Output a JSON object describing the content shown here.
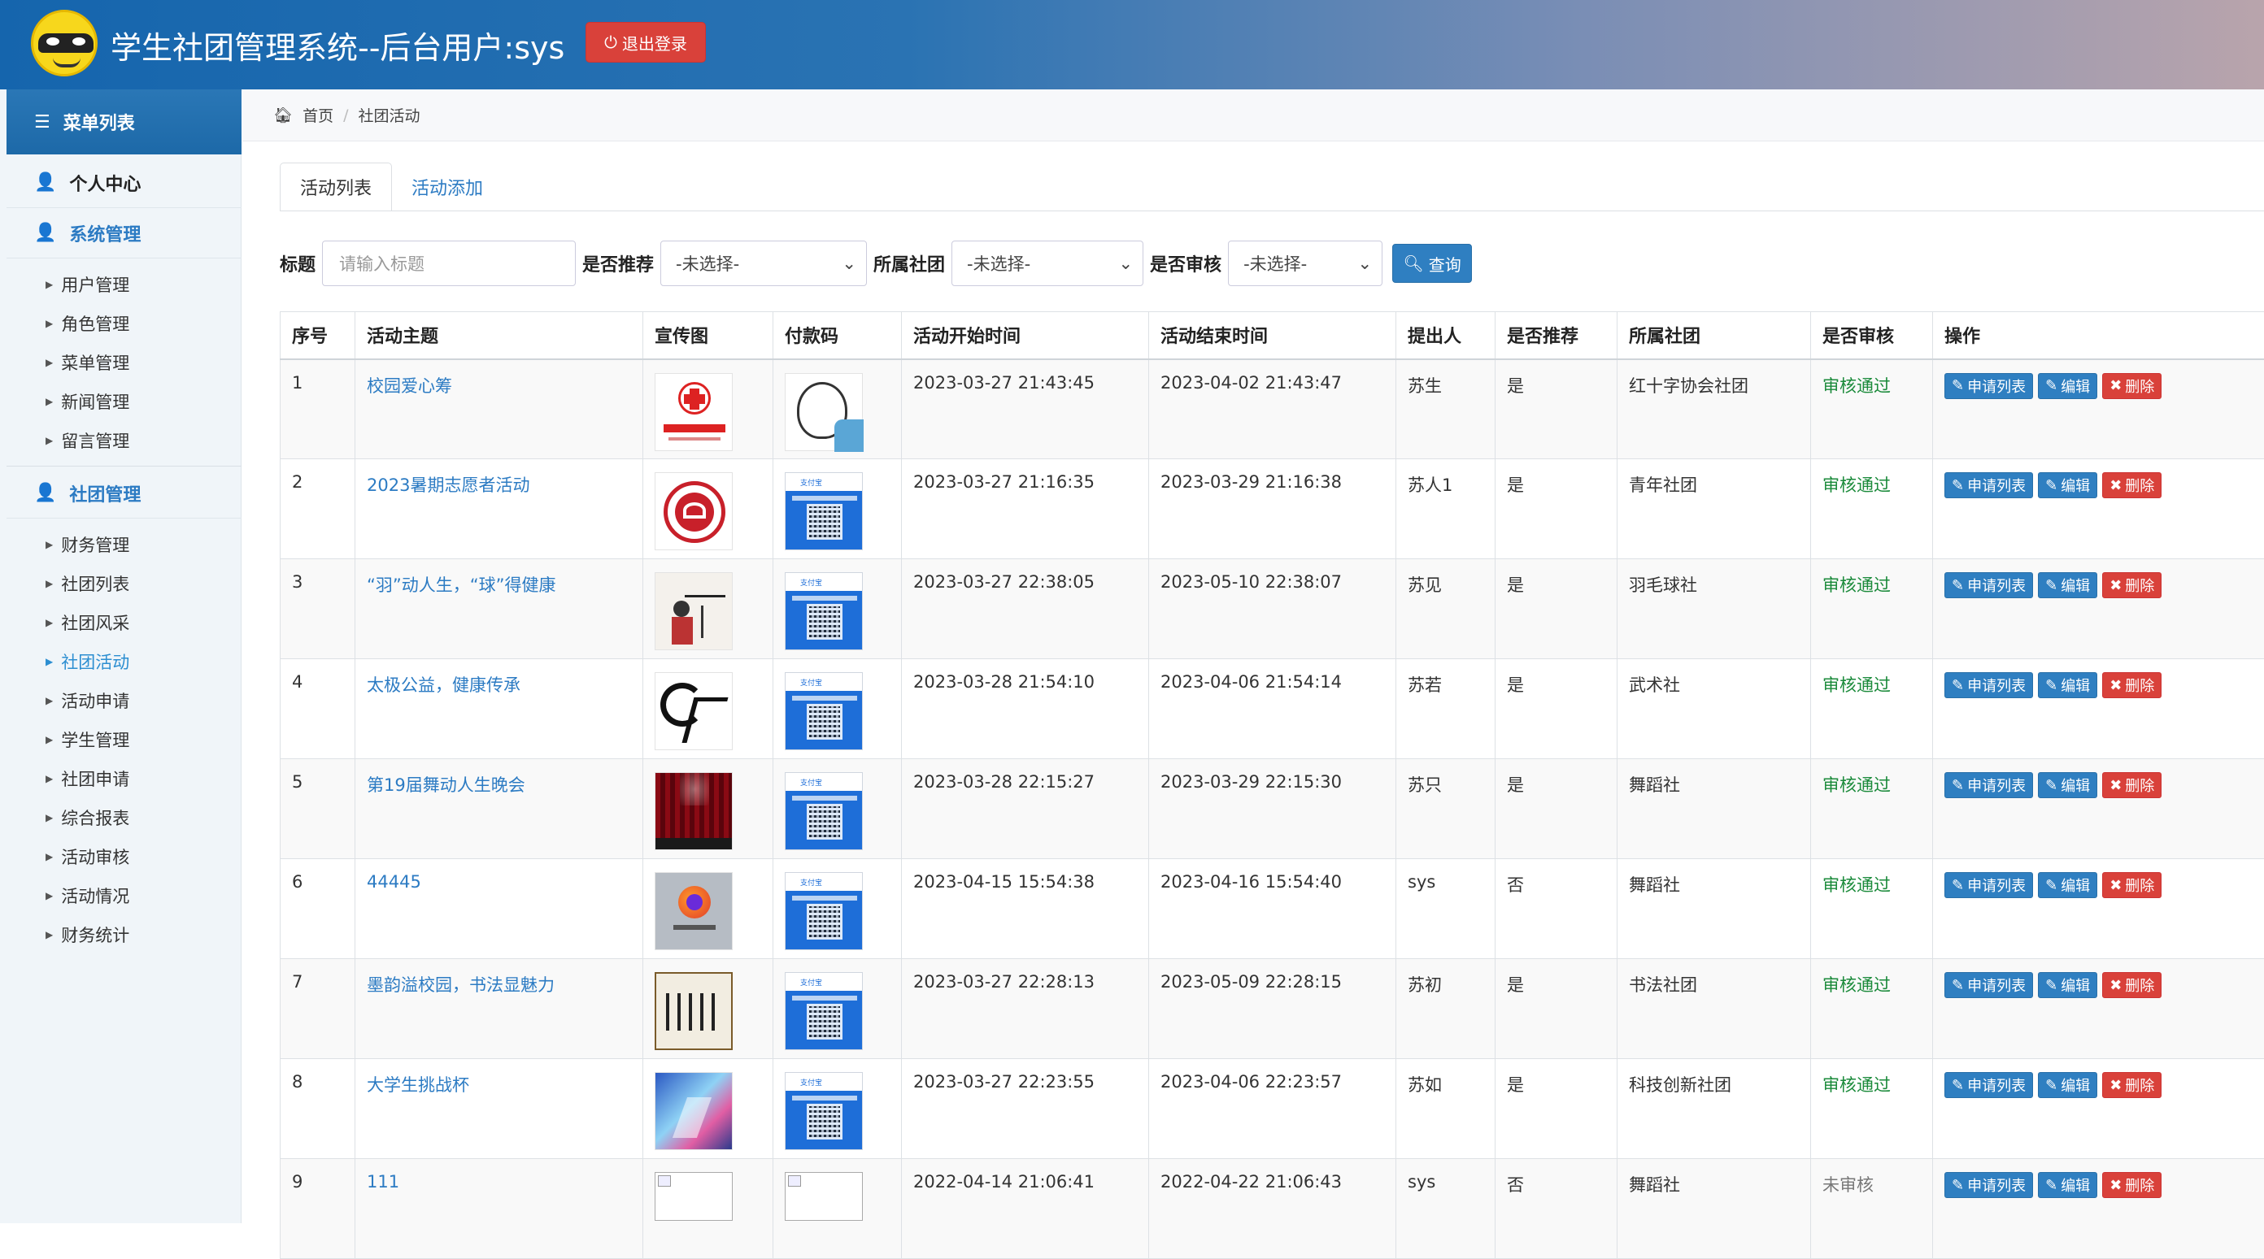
{
  "header": {
    "title": "学生社团管理系统--后台用户:sys",
    "logout_label": "退出登录"
  },
  "sidebar": {
    "menu_title": "菜单列表",
    "personal_center": "个人中心",
    "system_management": "系统管理",
    "system_items": [
      "用户管理",
      "角色管理",
      "菜单管理",
      "新闻管理",
      "留言管理"
    ],
    "club_management": "社团管理",
    "club_items": [
      "财务管理",
      "社团列表",
      "社团风采",
      "社团活动",
      "活动申请",
      "学生管理",
      "社团申请",
      "综合报表",
      "活动审核",
      "活动情况",
      "财务统计"
    ],
    "active_item": "社团活动"
  },
  "breadcrumb": {
    "home": "首页",
    "current": "社团活动"
  },
  "tabs": {
    "list": "活动列表",
    "add": "活动添加"
  },
  "filters": {
    "title_label": "标题",
    "title_placeholder": "请输入标题",
    "recommend_label": "是否推荐",
    "recommend_value": "-未选择-",
    "club_label": "所属社团",
    "club_value": "-未选择-",
    "audit_label": "是否审核",
    "audit_value": "-未选择-",
    "query_label": "查询"
  },
  "table": {
    "columns": [
      "序号",
      "活动主题",
      "宣传图",
      "付款码",
      "活动开始时间",
      "活动结束时间",
      "提出人",
      "是否推荐",
      "所属社团",
      "是否审核",
      "操作"
    ],
    "op_labels": {
      "apply": "申请列表",
      "edit": "编辑",
      "delete": "删除"
    },
    "rows": [
      {
        "no": "1",
        "topic": "校园爱心筹",
        "poster": "red-cross-logo",
        "pay": "sketch-avatar",
        "start": "2023-03-27 21:43:45",
        "end": "2023-04-02 21:43:47",
        "proposer": "苏生",
        "recommend": "是",
        "club": "红十字协会社团",
        "audit": "审核通过"
      },
      {
        "no": "2",
        "topic": "2023暑期志愿者活动",
        "poster": "volunteer-logo",
        "pay": "qr-code",
        "start": "2023-03-27 21:16:35",
        "end": "2023-03-29 21:16:38",
        "proposer": "苏人1",
        "recommend": "是",
        "club": "青年社团",
        "audit": "审核通过"
      },
      {
        "no": "3",
        "topic": "“羽”动人生，“球”得健康",
        "poster": "badminton-poster",
        "pay": "qr-code",
        "start": "2023-03-27 22:38:05",
        "end": "2023-05-10 22:38:07",
        "proposer": "苏见",
        "recommend": "是",
        "club": "羽毛球社",
        "audit": "审核通过"
      },
      {
        "no": "4",
        "topic": "太极公益，健康传承",
        "poster": "wushu-calligraphy",
        "pay": "qr-code",
        "start": "2023-03-28 21:54:10",
        "end": "2023-04-06 21:54:14",
        "proposer": "苏若",
        "recommend": "是",
        "club": "武术社",
        "audit": "审核通过"
      },
      {
        "no": "5",
        "topic": "第19届舞动人生晚会",
        "poster": "stage-curtain",
        "pay": "qr-code",
        "start": "2023-03-28 22:15:27",
        "end": "2023-03-29 22:15:30",
        "proposer": "苏只",
        "recommend": "是",
        "club": "舞蹈社",
        "audit": "审核通过"
      },
      {
        "no": "6",
        "topic": "44445",
        "poster": "firefox-screenshot",
        "pay": "qr-code",
        "start": "2023-04-15 15:54:38",
        "end": "2023-04-16 15:54:40",
        "proposer": "sys",
        "recommend": "否",
        "club": "舞蹈社",
        "audit": "审核通过"
      },
      {
        "no": "7",
        "topic": "墨韵溢校园，书法显魅力",
        "poster": "calligraphy-scroll",
        "pay": "qr-code",
        "start": "2023-03-27 22:28:13",
        "end": "2023-05-09 22:28:15",
        "proposer": "苏初",
        "recommend": "是",
        "club": "书法社团",
        "audit": "审核通过"
      },
      {
        "no": "8",
        "topic": "大学生挑战杯",
        "poster": "challenge-cup-poster",
        "pay": "qr-code",
        "start": "2023-03-27 22:23:55",
        "end": "2023-04-06 22:23:57",
        "proposer": "苏如",
        "recommend": "是",
        "club": "科技创新社团",
        "audit": "审核通过"
      },
      {
        "no": "9",
        "topic": "111",
        "poster": "broken-image",
        "pay": "broken-image",
        "start": "2022-04-14 21:06:41",
        "end": "2022-04-22 21:06:43",
        "proposer": "sys",
        "recommend": "否",
        "club": "舞蹈社",
        "audit": "未审核"
      }
    ]
  },
  "colors": {
    "primary": "#2f7fc1",
    "danger": "#d9413a",
    "link": "#2c7bc3",
    "passed": "#1a8a3a"
  }
}
